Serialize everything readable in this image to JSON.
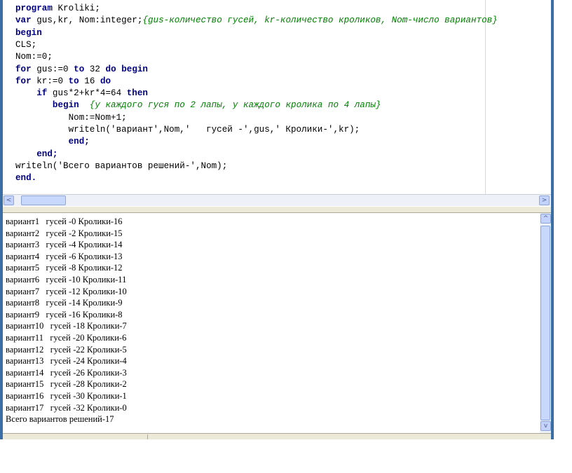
{
  "editor": {
    "lines": [
      [
        {
          "t": "program",
          "k": "kw"
        },
        {
          "t": " Kroliki;",
          "k": ""
        }
      ],
      [
        {
          "t": "var",
          "k": "kw"
        },
        {
          "t": " gus,kr, Nom:integer;",
          "k": ""
        },
        {
          "t": "{gus-количество гусей, kr-количество кроликов, Nom-число вариантов}",
          "k": "cm"
        }
      ],
      [
        {
          "t": "begin",
          "k": "kw"
        }
      ],
      [
        {
          "t": "CLS;",
          "k": ""
        }
      ],
      [
        {
          "t": "Nom:=0;",
          "k": ""
        }
      ],
      [
        {
          "t": "for",
          "k": "kw"
        },
        {
          "t": " gus:=0 ",
          "k": ""
        },
        {
          "t": "to",
          "k": "kw"
        },
        {
          "t": " 32 ",
          "k": ""
        },
        {
          "t": "do",
          "k": "kw"
        },
        {
          "t": " ",
          "k": ""
        },
        {
          "t": "begin",
          "k": "kw"
        }
      ],
      [
        {
          "t": "for",
          "k": "kw"
        },
        {
          "t": " kr:=0 ",
          "k": ""
        },
        {
          "t": "to",
          "k": "kw"
        },
        {
          "t": " 16 ",
          "k": ""
        },
        {
          "t": "do",
          "k": "kw"
        }
      ],
      [
        {
          "t": "    ",
          "k": ""
        },
        {
          "t": "if",
          "k": "kw"
        },
        {
          "t": " gus*2+kr*4=64 ",
          "k": ""
        },
        {
          "t": "then",
          "k": "kw"
        }
      ],
      [
        {
          "t": "       ",
          "k": ""
        },
        {
          "t": "begin",
          "k": "kw"
        },
        {
          "t": "  ",
          "k": ""
        },
        {
          "t": "{у каждого гуся по 2 лапы, у каждого кролика по 4 лапы}",
          "k": "cm"
        }
      ],
      [
        {
          "t": "          Nom:=Nom+1;",
          "k": ""
        }
      ],
      [
        {
          "t": "          writeln('вариант',Nom,'   гусей -',gus,' Кролики-',kr);",
          "k": ""
        }
      ],
      [
        {
          "t": "          ",
          "k": ""
        },
        {
          "t": "end;",
          "k": "kw"
        }
      ],
      [
        {
          "t": "    ",
          "k": ""
        },
        {
          "t": "end;",
          "k": "kw"
        }
      ],
      [
        {
          "t": "writeln('Всего вариантов решений-',Nom);",
          "k": ""
        }
      ],
      [
        {
          "t": "end.",
          "k": "kw"
        }
      ]
    ]
  },
  "output": {
    "lines": [
      "вариант1   гусей -0 Кролики-16",
      "вариант2   гусей -2 Кролики-15",
      "вариант3   гусей -4 Кролики-14",
      "вариант4   гусей -6 Кролики-13",
      "вариант5   гусей -8 Кролики-12",
      "вариант6   гусей -10 Кролики-11",
      "вариант7   гусей -12 Кролики-10",
      "вариант8   гусей -14 Кролики-9",
      "вариант9   гусей -16 Кролики-8",
      "вариант10   гусей -18 Кролики-7",
      "вариант11   гусей -20 Кролики-6",
      "вариант12   гусей -22 Кролики-5",
      "вариант13   гусей -24 Кролики-4",
      "вариант14   гусей -26 Кролики-3",
      "вариант15   гусей -28 Кролики-2",
      "вариант16   гусей -30 Кролики-1",
      "вариант17   гусей -32 Кролики-0",
      "Всего вариантов решений-17"
    ]
  },
  "scrollbars": {
    "left_arrow": "<",
    "right_arrow": ">",
    "up_arrow": "^",
    "down_arrow": "v"
  },
  "colors": {
    "keyword": "#000080",
    "comment": "#008000",
    "frame": "#3a6ea5"
  }
}
